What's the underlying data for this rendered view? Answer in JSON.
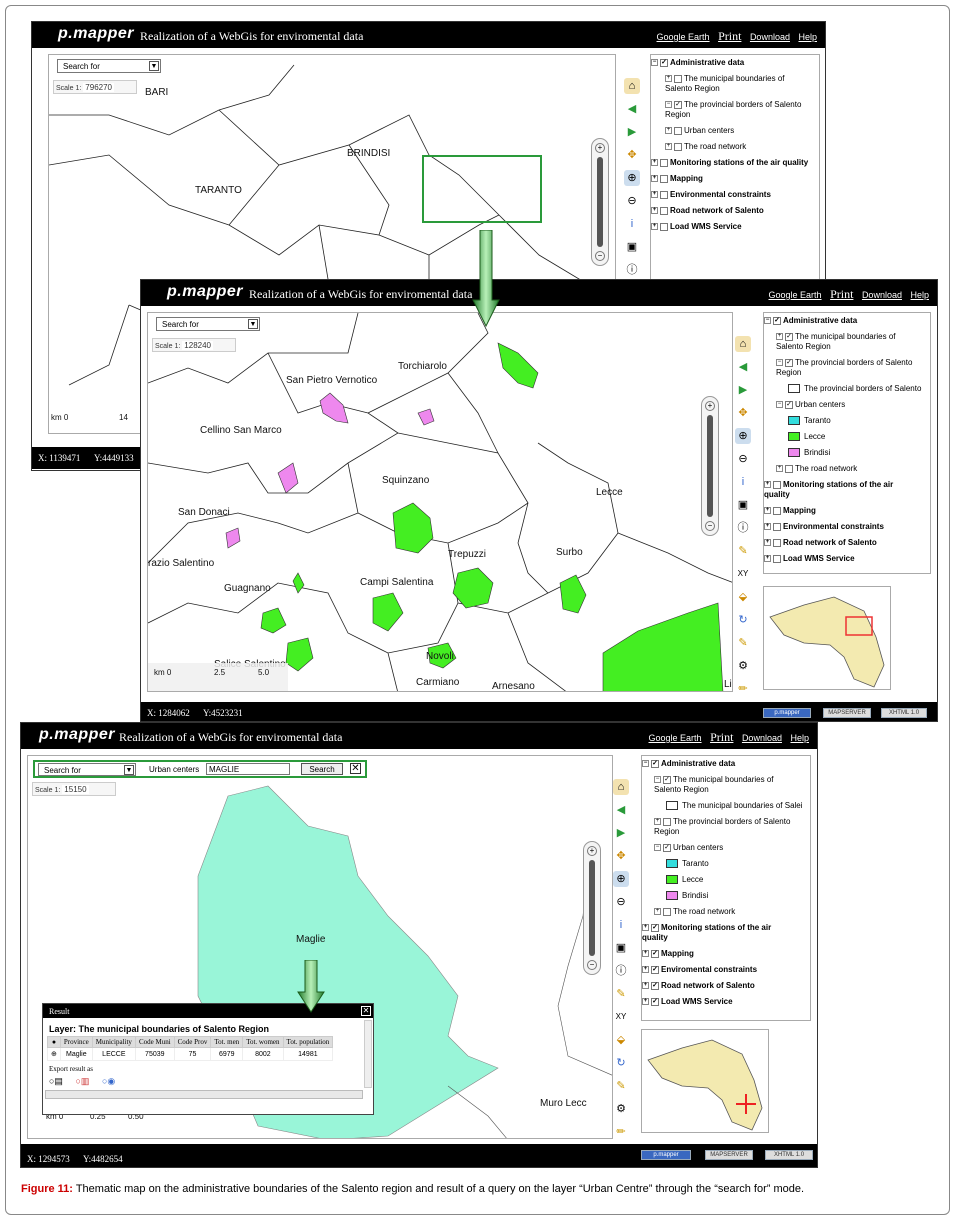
{
  "app": {
    "logo": "p.mapper",
    "title": "Realization of a WebGis for enviromental data",
    "tools": {
      "google_earth": "Google Earth",
      "print": "Print",
      "download": "Download",
      "help": "Help"
    },
    "search_for": "Search for"
  },
  "screen1": {
    "scale_label": "Scale 1:",
    "scale_value": "796270",
    "labels": {
      "bari": "BARI",
      "brindisi": "BRINDISI",
      "taranto": "TARANTO"
    },
    "scalebar": {
      "km": "km 0",
      "mid": "14"
    },
    "coords": {
      "x": "X: 1139471",
      "y": "Y:4449133"
    },
    "toc": [
      "Administrative data",
      "The municipal boundaries of Salento Region",
      "The provincial borders of Salento Region",
      "Urban centers",
      "The road network",
      "Monitoring stations of the air quality",
      "Mapping",
      "Environmental constraints",
      "Road network of Salento",
      "Load WMS Service"
    ]
  },
  "screen2": {
    "scale_label": "Scale 1:",
    "scale_value": "128240",
    "labels": {
      "torchiarolo": "Torchiarolo",
      "spv": "San Pietro Vernotico",
      "cellino": "Cellino San Marco",
      "squinzano": "Squinzano",
      "lecce": "Lecce",
      "sandonaci": "San Donaci",
      "trepuzzi": "Trepuzzi",
      "surbo": "Surbo",
      "razio": "razio Salentino",
      "guagnano": "Guagnano",
      "campi": "Campi Salentina",
      "novoli": "Novoli",
      "salice": "Salice Salentino",
      "carmiano": "Carmiano",
      "arnesano": "Arnesano",
      "li": "Li"
    },
    "scalebar": {
      "km": "km 0",
      "a": "2.5",
      "b": "5.0"
    },
    "coords": {
      "x": "X: 1284062",
      "y": "Y:4523231"
    },
    "toc": {
      "admin": "Administrative data",
      "municipal": "The municipal boundaries of Salento Region",
      "provincial": "The provincial borders of Salento Region",
      "provincial_sub": "The provincial borders of Salento",
      "urban": "Urban centers",
      "taranto": "Taranto",
      "lecce": "Lecce",
      "brindisi": "Brindisi",
      "road": "The road network",
      "monitoring": "Monitoring stations of the air quality",
      "mapping": "Mapping",
      "env": "Environmental constraints",
      "roadsal": "Road network of Salento",
      "wms": "Load WMS Service"
    }
  },
  "screen3": {
    "search_layer": "Urban centers",
    "search_value": "MAGLIE",
    "search_button": "Search",
    "scale_label": "Scale 1:",
    "scale_value": "15150",
    "labels": {
      "maglie": "Maglie",
      "muro": "Muro Lecc"
    },
    "scalebar": {
      "km": "km 0",
      "a": "0.25",
      "b": "0.50"
    },
    "coords": {
      "x": "X: 1294573",
      "y": "Y:4482654"
    },
    "toc": {
      "admin": "Administrative data",
      "municipal": "The municipal boundaries of Salento Region",
      "municipal_sub": "The municipal boundaries of Salei",
      "provincial": "The provincial borders of Salento Region",
      "urban": "Urban centers",
      "taranto": "Taranto",
      "lecce": "Lecce",
      "brindisi": "Brindisi",
      "road": "The road network",
      "monitoring": "Monitoring stations of the air quality",
      "mapping": "Mapping",
      "env": "Enviromental constraints",
      "roadsal": "Road network of Salento",
      "wms": "Load WMS Service"
    },
    "result": {
      "title": "Result",
      "layer": "Layer: The municipal boundaries of Salento Region",
      "headers": [
        "Province",
        "Municipality",
        "Code Muni",
        "Code Prov",
        "Tot. men",
        "Tot. women",
        "Tot. population"
      ],
      "row": [
        "Maglie",
        "LECCE",
        "75039",
        "75",
        "6979",
        "8002",
        "14981"
      ],
      "export": "Export result as"
    }
  },
  "badges": {
    "pmapper": "p.mapper",
    "mapserver": "MAPSERVER",
    "w3c": "XHTML 1.0"
  },
  "caption": {
    "bold": "Figure 11:",
    "text": " Thematic map on the administrative boundaries of the Salento region and result of a query on the layer “Urban Centre” through the “search for” mode."
  },
  "colors": {
    "taranto": "#33dddd",
    "lecce": "#44ee22",
    "brindisi": "#ee88ee",
    "maglie": "#99f5d8",
    "highlight": "#2a9a3a"
  }
}
